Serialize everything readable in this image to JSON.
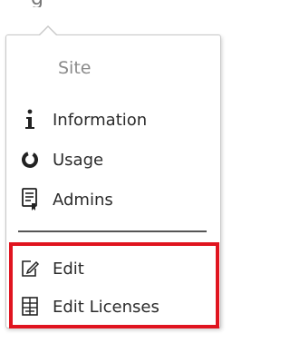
{
  "background": {
    "fragment_text": "g"
  },
  "menu": {
    "section_title": "Site",
    "items": [
      {
        "label": "Information",
        "icon": "info-icon"
      },
      {
        "label": "Usage",
        "icon": "usage-ring-icon"
      },
      {
        "label": "Admins",
        "icon": "admin-badge-icon"
      }
    ],
    "edit_items": [
      {
        "label": "Edit",
        "icon": "edit-pencil-icon"
      },
      {
        "label": "Edit Licenses",
        "icon": "licenses-grid-icon"
      }
    ]
  },
  "colors": {
    "highlight_border": "#e0141f",
    "section_title": "#8a8a8a",
    "text": "#2b2b2b"
  }
}
